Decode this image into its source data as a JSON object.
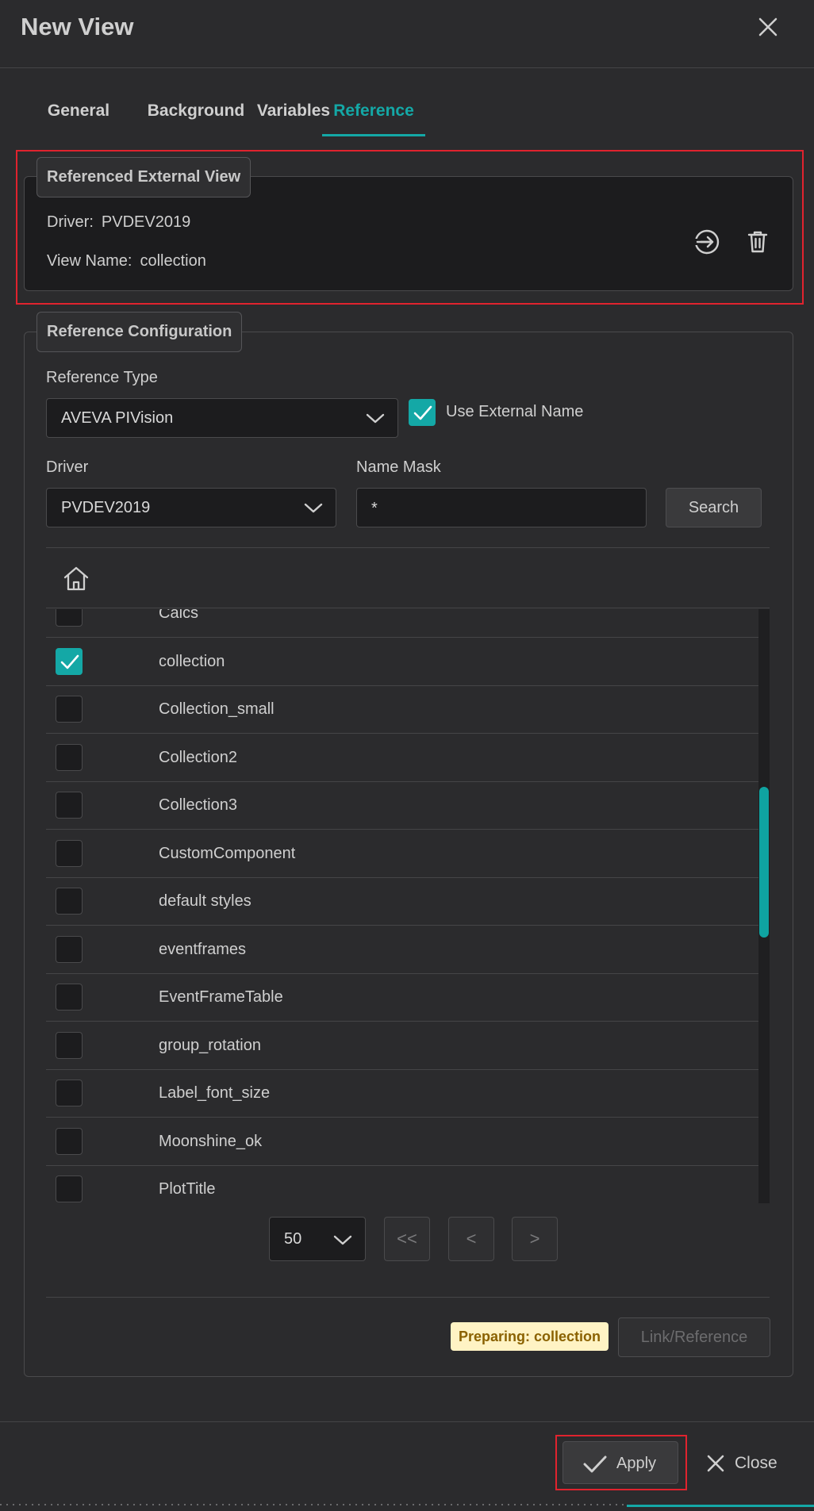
{
  "dialog": {
    "title": "New View",
    "close_icon": "close-icon"
  },
  "tabs": [
    {
      "label": "General",
      "active": false
    },
    {
      "label": "Background",
      "active": false
    },
    {
      "label": "Variables",
      "active": false
    },
    {
      "label": "Reference",
      "active": true
    }
  ],
  "referenced_external_view": {
    "legend": "Referenced External View",
    "driver_label": "Driver:",
    "driver_value": "PVDEV2019",
    "view_name_label": "View Name:",
    "view_name_value": "collection",
    "open_icon": "sign-in-icon",
    "delete_icon": "trash-icon"
  },
  "reference_configuration": {
    "legend": "Reference Configuration",
    "reference_type_label": "Reference Type",
    "reference_type_value": "AVEVA PIVision",
    "use_external_name_label": "Use External Name",
    "use_external_name_checked": true,
    "driver_label": "Driver",
    "driver_value": "PVDEV2019",
    "name_mask_label": "Name Mask",
    "name_mask_value": "*",
    "search_label": "Search",
    "home_icon": "home-icon"
  },
  "list": {
    "items": [
      {
        "name": "Calcs",
        "checked": false
      },
      {
        "name": "collection",
        "checked": true
      },
      {
        "name": "Collection_small",
        "checked": false
      },
      {
        "name": "Collection2",
        "checked": false
      },
      {
        "name": "Collection3",
        "checked": false
      },
      {
        "name": "CustomComponent",
        "checked": false
      },
      {
        "name": "default styles",
        "checked": false
      },
      {
        "name": "eventframes",
        "checked": false
      },
      {
        "name": "EventFrameTable",
        "checked": false
      },
      {
        "name": "group_rotation",
        "checked": false
      },
      {
        "name": "Label_font_size",
        "checked": false
      },
      {
        "name": "Moonshine_ok",
        "checked": false
      },
      {
        "name": "PlotTitle",
        "checked": false
      }
    ]
  },
  "pager": {
    "page_size": "50",
    "first_label": "<<",
    "prev_label": "<",
    "next_label": ">"
  },
  "status_badge": "Preparing: collection",
  "link_reference_label": "Link/Reference",
  "footer": {
    "apply_label": "Apply",
    "close_label": "Close"
  },
  "colors": {
    "accent": "#14a8a6",
    "highlight": "#e0232e",
    "badge_bg": "#fff3c4"
  }
}
